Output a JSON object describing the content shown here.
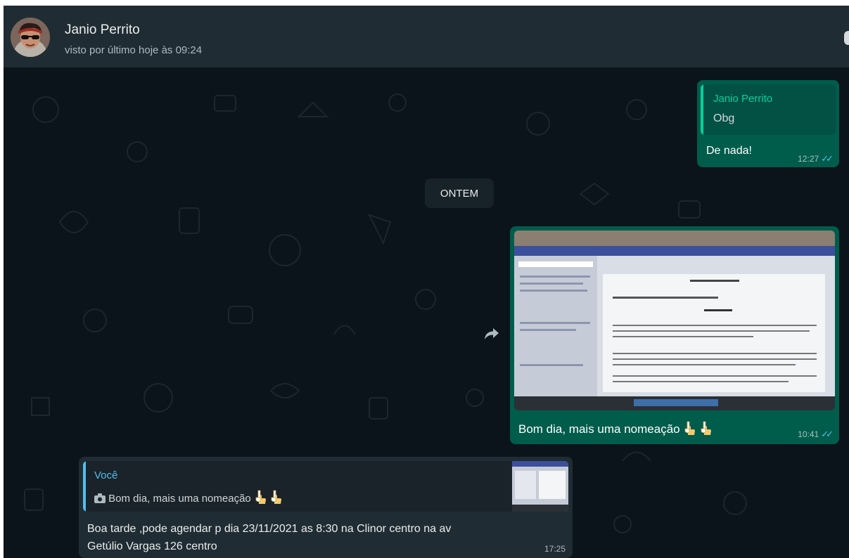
{
  "header": {
    "contact_name": "Janio Perrito",
    "last_seen": "visto por último hoje às 09:24"
  },
  "messages": {
    "reply_de_nada": {
      "quote_author": "Janio Perrito",
      "quote_text": "Obg",
      "text": "De nada!",
      "time": "12:27",
      "ticks": "✓✓"
    },
    "date_separator": "ONTEM",
    "image_message": {
      "caption": "Bom dia, mais uma nomeação",
      "time": "10:41",
      "ticks": "✓✓"
    },
    "incoming_reply": {
      "quote_author": "Você",
      "quote_text": "Bom dia, mais uma nomeação",
      "text_line1": "Boa tarde ,pode agendar p dia 23/11/2021 as 8:30 na Clinor centro na av",
      "text_line2": "Getúlio Vargas 126 centro",
      "time": "17:25"
    }
  },
  "icons": {
    "forward": "forward-icon",
    "camera": "camera-icon",
    "hand": "backhand-index-pointing-down-emoji",
    "read_ticks": "double-check-icon"
  },
  "colors": {
    "chat_background": "#0b141a",
    "header_background": "#202c33",
    "outgoing_bubble": "#005c4b",
    "incoming_bubble": "#202c33",
    "quote_author_green": "#06cf9c",
    "quote_author_blue": "#53bdeb",
    "read_ticks": "#53bdeb"
  }
}
